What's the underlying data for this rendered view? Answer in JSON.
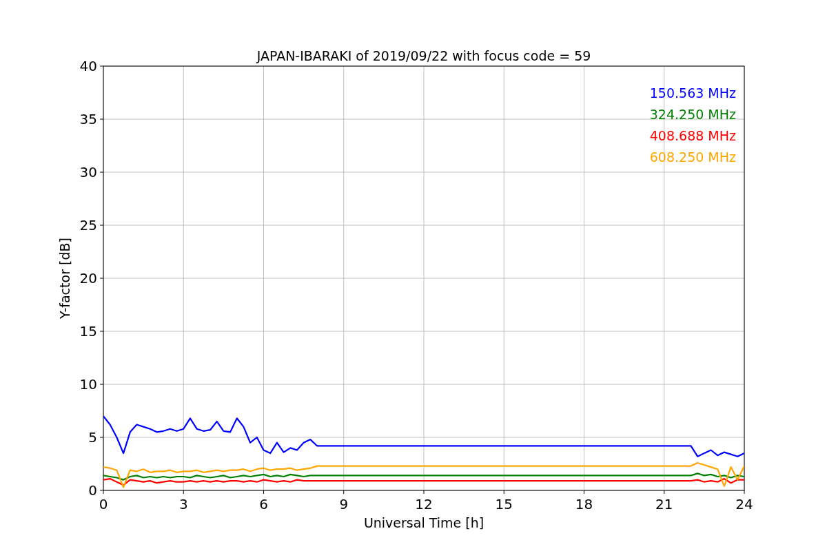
{
  "figure": {
    "chart_data": {
      "type": "line",
      "title": "JAPAN-IBARAKI of 2019/09/22 with focus code = 59",
      "xlabel": "Universal Time [h]",
      "ylabel": "Y-factor [dB]",
      "x": [
        0,
        0.25,
        0.5,
        0.75,
        1,
        1.25,
        1.5,
        1.75,
        2,
        2.25,
        2.5,
        2.75,
        3,
        3.25,
        3.5,
        3.75,
        4,
        4.25,
        4.5,
        4.75,
        5,
        5.25,
        5.5,
        5.75,
        6,
        6.25,
        6.5,
        6.75,
        7,
        7.25,
        7.5,
        7.75,
        8,
        22,
        22.25,
        22.5,
        22.75,
        23,
        23.25,
        23.5,
        23.75,
        24
      ],
      "series": [
        {
          "name": "150.563 MHz",
          "color": "#0000ff",
          "values": [
            7.0,
            6.2,
            5.0,
            3.5,
            5.5,
            6.2,
            6.0,
            5.8,
            5.5,
            5.6,
            5.8,
            5.6,
            5.8,
            6.8,
            5.8,
            5.6,
            5.7,
            6.5,
            5.6,
            5.5,
            6.8,
            6.0,
            4.5,
            5.0,
            3.8,
            3.5,
            4.5,
            3.6,
            4.0,
            3.8,
            4.5,
            4.8,
            4.2,
            4.2,
            3.2,
            3.5,
            3.8,
            3.3,
            3.6,
            3.4,
            3.2,
            3.5
          ]
        },
        {
          "name": "324.250 MHz",
          "color": "#008000",
          "values": [
            1.4,
            1.3,
            1.2,
            1.0,
            1.3,
            1.4,
            1.2,
            1.3,
            1.2,
            1.3,
            1.2,
            1.3,
            1.3,
            1.2,
            1.4,
            1.3,
            1.2,
            1.3,
            1.4,
            1.2,
            1.3,
            1.4,
            1.3,
            1.4,
            1.5,
            1.3,
            1.4,
            1.3,
            1.5,
            1.4,
            1.3,
            1.4,
            1.4,
            1.4,
            1.6,
            1.4,
            1.5,
            1.3,
            1.4,
            1.2,
            1.4,
            1.3
          ]
        },
        {
          "name": "408.688 MHz",
          "color": "#ff0000",
          "values": [
            1.0,
            1.1,
            0.8,
            0.5,
            1.0,
            0.9,
            0.8,
            0.9,
            0.7,
            0.8,
            0.9,
            0.8,
            0.8,
            0.9,
            0.8,
            0.9,
            0.8,
            0.9,
            0.8,
            0.9,
            0.9,
            0.8,
            0.9,
            0.8,
            1.0,
            0.9,
            0.8,
            0.9,
            0.8,
            1.0,
            0.9,
            0.9,
            0.9,
            0.9,
            1.0,
            0.8,
            0.9,
            0.8,
            1.1,
            0.7,
            1.0,
            1.0
          ]
        },
        {
          "name": "608.250 MHz",
          "color": "#ffa500",
          "values": [
            2.2,
            2.1,
            1.9,
            0.3,
            1.9,
            1.8,
            2.0,
            1.7,
            1.8,
            1.8,
            1.9,
            1.7,
            1.8,
            1.8,
            1.9,
            1.7,
            1.8,
            1.9,
            1.8,
            1.9,
            1.9,
            2.0,
            1.8,
            2.0,
            2.1,
            1.9,
            2.0,
            2.0,
            2.1,
            1.9,
            2.0,
            2.1,
            2.3,
            2.3,
            2.6,
            2.4,
            2.2,
            2.0,
            0.4,
            2.2,
            1.0,
            2.3
          ]
        }
      ],
      "grid": true,
      "xlim": [
        0,
        24
      ],
      "ylim": [
        0,
        40
      ],
      "xticks": [
        0,
        3,
        6,
        9,
        12,
        15,
        18,
        21,
        24
      ],
      "yticks": [
        0,
        5,
        10,
        15,
        20,
        25,
        30,
        35,
        40
      ]
    }
  }
}
